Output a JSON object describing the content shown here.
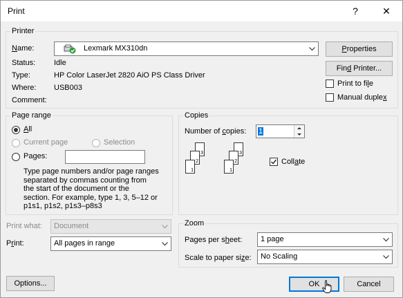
{
  "window": {
    "title": "Print",
    "help": "?",
    "close": "✕"
  },
  "printer": {
    "legend": "Printer",
    "name_label_pre": "",
    "name_label_u": "N",
    "name_label_post": "ame:",
    "name_value": "Lexmark MX310dn",
    "status_label": "Status:",
    "status_value": "Idle",
    "type_label": "Type:",
    "type_value": "HP Color LaserJet 2820 AiO PS Class Driver",
    "where_label": "Where:",
    "where_value": "USB003",
    "comment_label": "Comment:",
    "properties_pre": "",
    "properties_u": "P",
    "properties_post": "roperties",
    "find_pre": "Fin",
    "find_u": "d",
    "find_post": " Printer...",
    "print_to_file_pre": "Print to fi",
    "print_to_file_u": "l",
    "print_to_file_post": "e",
    "manual_duplex_pre": "Manual duple",
    "manual_duplex_u": "x",
    "manual_duplex_post": ""
  },
  "page_range": {
    "legend": "Page range",
    "all_pre": "",
    "all_u": "A",
    "all_post": "ll",
    "current_page": "Current page",
    "selection": "Selection",
    "pages_pre": "Pa",
    "pages_u": "g",
    "pages_post": "es:",
    "help_lines": [
      "Type page numbers and/or page ranges",
      "separated by commas counting from",
      "the start of the document or the",
      "section. For example, type 1, 3, 5–12 or",
      "p1s1, p1s2, p1s3–p8s3"
    ]
  },
  "copies": {
    "legend": "Copies",
    "num_label_pre": "Number of ",
    "num_label_u": "c",
    "num_label_post": "opies:",
    "num_value": "1",
    "collate_pre": "Coll",
    "collate_u": "a",
    "collate_post": "te",
    "icon_pages": [
      "1",
      "2",
      "3"
    ]
  },
  "print_what": {
    "label": "Print what:",
    "value": "Document"
  },
  "print": {
    "label_pre": "P",
    "label_u": "r",
    "label_post": "int:",
    "value": "All pages in range"
  },
  "zoom": {
    "legend": "Zoom",
    "pps_label_pre": "Pages per s",
    "pps_label_u": "h",
    "pps_label_post": "eet:",
    "pps_value": "1 page",
    "scale_label_pre": "Scale to paper si",
    "scale_label_u": "z",
    "scale_label_post": "e:",
    "scale_value": "No Scaling"
  },
  "buttons": {
    "options": "Options...",
    "ok": "OK",
    "cancel": "Cancel"
  }
}
